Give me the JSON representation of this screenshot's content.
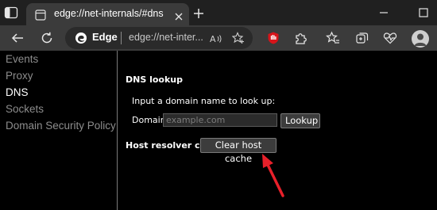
{
  "tab": {
    "title": "edge://net-internals/#dns"
  },
  "omnibox": {
    "brand": "Edge",
    "url": "edge://net-inter..."
  },
  "sidebar": {
    "items": [
      {
        "label": "Events"
      },
      {
        "label": "Proxy"
      },
      {
        "label": "DNS"
      },
      {
        "label": "Sockets"
      },
      {
        "label": "Domain Security Policy"
      }
    ],
    "active_item": "DNS"
  },
  "dns": {
    "heading": "DNS lookup",
    "prompt": "Input a domain name to look up:",
    "domain_label": "Domain:",
    "domain_placeholder": "example.com",
    "domain_value": "",
    "lookup_label": "Lookup",
    "resolver_label": "Host resolver cache",
    "clear_label": "Clear host cache"
  },
  "icons": {
    "tab_actions": "tab-actions-icon",
    "favicon": "settings-page-icon",
    "close": "close-icon",
    "new_tab": "plus-icon",
    "minimize": "minimize-icon",
    "maximize": "maximize-icon",
    "back": "back-arrow-icon",
    "refresh": "refresh-icon",
    "edge": "edge-logo-icon",
    "read_aloud": "read-aloud-icon",
    "add_favorite": "add-favorite-icon",
    "extension_red": "red-extension-icon",
    "extensions": "extensions-puzzle-icon",
    "favorites": "favorites-icon",
    "collections": "collections-icon",
    "health": "browser-essentials-icon",
    "profile": "profile-avatar-icon"
  },
  "colors": {
    "annotation_arrow": "#e8202a",
    "background": "#000000",
    "toolbar": "#3b3b3b"
  }
}
